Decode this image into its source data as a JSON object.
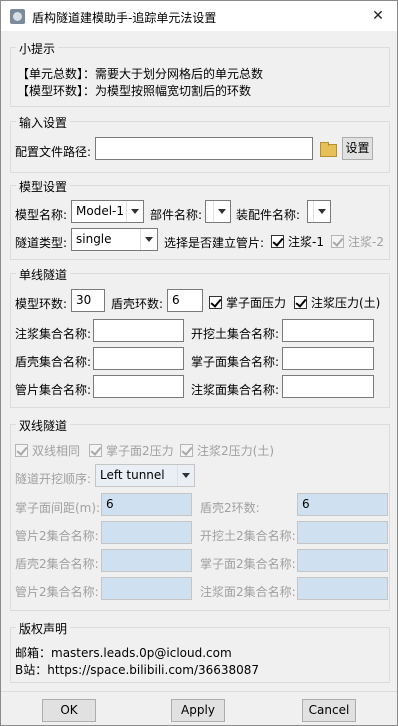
{
  "window": {
    "title": "盾构隧道建模助手-追踪单元法设置",
    "close_glyph": "✕"
  },
  "hints": {
    "legend": "小提示",
    "line1": "【单元总数】：需要大于划分网格后的单元总数",
    "line2": "【模型环数】：为模型按照幅宽切割后的环数"
  },
  "input_settings": {
    "legend": "输入设置",
    "config_path_label": "配置文件路径:",
    "config_path_value": "",
    "set_button": "设置"
  },
  "model_settings": {
    "legend": "模型设置",
    "model_name_label": "模型名称:",
    "model_name_value": "Model-1",
    "part_name_label": "部件名称:",
    "part_name_value": "",
    "assembly_name_label": "装配件名称:",
    "assembly_name_value": "",
    "tunnel_type_label": "隧道类型:",
    "tunnel_type_value": "single",
    "pipe_label": "选择是否建立管片:",
    "grout1_label": "注浆-1",
    "grout1_checked": true,
    "grout2_label": "注浆-2",
    "grout2_checked": true
  },
  "single_tunnel": {
    "legend": "单线隧道",
    "model_rings_label": "模型环数:",
    "model_rings_value": "30",
    "shield_rings_label": "盾壳环数:",
    "shield_rings_value": "6",
    "face_pressure_label": "掌子面压力",
    "face_pressure_checked": true,
    "grout_pressure_label": "注浆压力(土)",
    "grout_pressure_checked": true,
    "grout_set_label": "注浆集合名称:",
    "grout_set_value": "",
    "excavation_set_label": "开挖土集合名称:",
    "excavation_set_value": "",
    "shield_set_label": "盾壳集合名称:",
    "shield_set_value": "",
    "face_set_label": "掌子面集合名称:",
    "face_set_value": "",
    "segment_set_label": "管片集合名称:",
    "segment_set_value": "",
    "grout_face_set_label": "注浆面集合名称:",
    "grout_face_set_value": ""
  },
  "double_tunnel": {
    "legend": "双线隧道",
    "same_label": "双线相同",
    "same_checked": true,
    "face2_label": "掌子面2压力",
    "face2_checked": true,
    "grout2_label": "注浆2压力(土)",
    "grout2_checked": true,
    "order_label": "隧道开挖顺序:",
    "order_value": "Left tunnel",
    "face_distance_label": "掌子面间距(m):",
    "face_distance_value": "6",
    "shield2_rings_label": "盾壳2环数:",
    "shield2_rings_value": "6",
    "segment2_set_label": "管片2集合名称:",
    "segment2_set_value": "",
    "excavation2_set_label": "开挖土2集合名称:",
    "excavation2_set_value": "",
    "shield2_set_label": "盾壳2集合名称:",
    "shield2_set_value": "",
    "face2_set_label": "掌子面2集合名称:",
    "face2_set_value": "",
    "segment2b_set_label": "管片2集合名称:",
    "segment2b_set_value": "",
    "grout_face2_set_label": "注浆面2集合名称:",
    "grout_face2_set_value": ""
  },
  "copyright": {
    "legend": "版权声明",
    "email": "邮箱：masters.leads.0p@icloud.com",
    "bilibili": "B站：https://space.bilibili.com/36638087"
  },
  "buttons": {
    "ok": "OK",
    "apply": "Apply",
    "cancel": "Cancel"
  },
  "icons": {
    "app": "app-icon",
    "close": "close-icon",
    "folder": "folder-open-icon"
  }
}
